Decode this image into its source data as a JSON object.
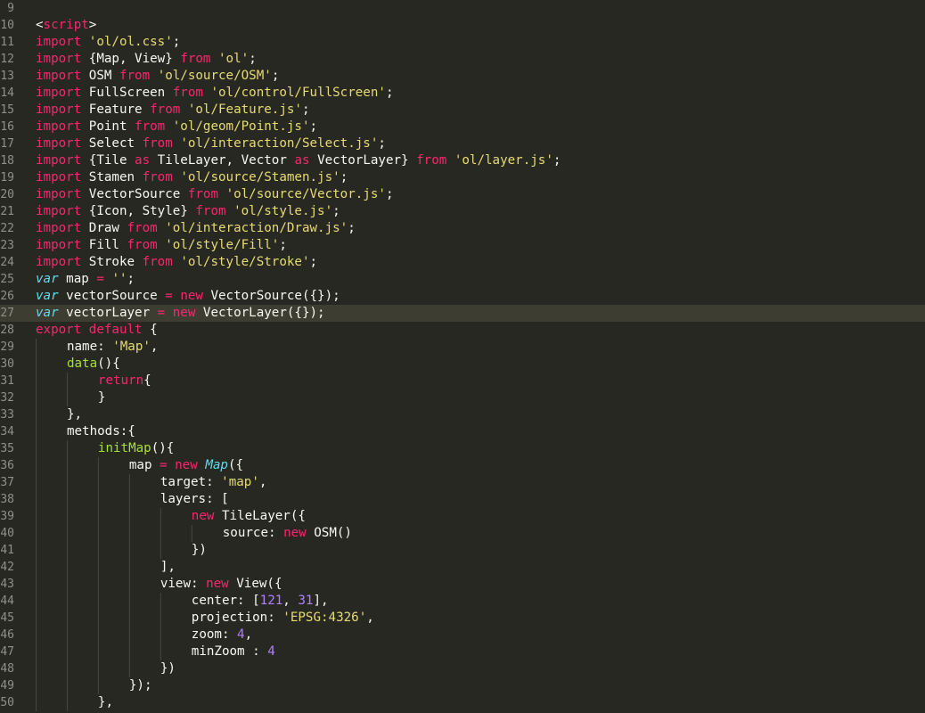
{
  "editor": {
    "theme": "Monokai",
    "colors": {
      "background": "#272822",
      "current_line": "#3e3d32",
      "gutter_text": "#90908a",
      "plain": "#f8f8f2",
      "keyword": "#f92672",
      "string": "#e6db74",
      "number": "#ae81ff",
      "function": "#a6e22e",
      "storage": "#66d9ef"
    },
    "current_line": 27,
    "lines": [
      {
        "no": "9",
        "indent": 0,
        "tokens": []
      },
      {
        "no": "10",
        "indent": 0,
        "tokens": [
          {
            "t": "p",
            "v": "<"
          },
          {
            "t": "k",
            "v": "script"
          },
          {
            "t": "p",
            "v": ">"
          }
        ]
      },
      {
        "no": "11",
        "indent": 0,
        "tokens": [
          {
            "t": "k",
            "v": "import"
          },
          {
            "t": "p",
            "v": " "
          },
          {
            "t": "s",
            "v": "'ol/ol.css'"
          },
          {
            "t": "p",
            "v": ";"
          }
        ]
      },
      {
        "no": "12",
        "indent": 0,
        "tokens": [
          {
            "t": "k",
            "v": "import"
          },
          {
            "t": "p",
            "v": " {Map, View} "
          },
          {
            "t": "k",
            "v": "from"
          },
          {
            "t": "p",
            "v": " "
          },
          {
            "t": "s",
            "v": "'ol'"
          },
          {
            "t": "p",
            "v": ";"
          }
        ]
      },
      {
        "no": "13",
        "indent": 0,
        "tokens": [
          {
            "t": "k",
            "v": "import"
          },
          {
            "t": "p",
            "v": " OSM "
          },
          {
            "t": "k",
            "v": "from"
          },
          {
            "t": "p",
            "v": " "
          },
          {
            "t": "s",
            "v": "'ol/source/OSM'"
          },
          {
            "t": "p",
            "v": ";"
          }
        ]
      },
      {
        "no": "14",
        "indent": 0,
        "tokens": [
          {
            "t": "k",
            "v": "import"
          },
          {
            "t": "p",
            "v": " FullScreen "
          },
          {
            "t": "k",
            "v": "from"
          },
          {
            "t": "p",
            "v": " "
          },
          {
            "t": "s",
            "v": "'ol/control/FullScreen'"
          },
          {
            "t": "p",
            "v": ";"
          }
        ]
      },
      {
        "no": "15",
        "indent": 0,
        "tokens": [
          {
            "t": "k",
            "v": "import"
          },
          {
            "t": "p",
            "v": " Feature "
          },
          {
            "t": "k",
            "v": "from"
          },
          {
            "t": "p",
            "v": " "
          },
          {
            "t": "s",
            "v": "'ol/Feature.js'"
          },
          {
            "t": "p",
            "v": ";"
          }
        ]
      },
      {
        "no": "16",
        "indent": 0,
        "tokens": [
          {
            "t": "k",
            "v": "import"
          },
          {
            "t": "p",
            "v": " Point "
          },
          {
            "t": "k",
            "v": "from"
          },
          {
            "t": "p",
            "v": " "
          },
          {
            "t": "s",
            "v": "'ol/geom/Point.js'"
          },
          {
            "t": "p",
            "v": ";"
          }
        ]
      },
      {
        "no": "17",
        "indent": 0,
        "tokens": [
          {
            "t": "k",
            "v": "import"
          },
          {
            "t": "p",
            "v": " Select "
          },
          {
            "t": "k",
            "v": "from"
          },
          {
            "t": "p",
            "v": " "
          },
          {
            "t": "s",
            "v": "'ol/interaction/Select.js'"
          },
          {
            "t": "p",
            "v": ";"
          }
        ]
      },
      {
        "no": "18",
        "indent": 0,
        "tokens": [
          {
            "t": "k",
            "v": "import"
          },
          {
            "t": "p",
            "v": " {Tile "
          },
          {
            "t": "k",
            "v": "as"
          },
          {
            "t": "p",
            "v": " TileLayer, Vector "
          },
          {
            "t": "k",
            "v": "as"
          },
          {
            "t": "p",
            "v": " VectorLayer} "
          },
          {
            "t": "k",
            "v": "from"
          },
          {
            "t": "p",
            "v": " "
          },
          {
            "t": "s",
            "v": "'ol/layer.js'"
          },
          {
            "t": "p",
            "v": ";"
          }
        ]
      },
      {
        "no": "19",
        "indent": 0,
        "tokens": [
          {
            "t": "k",
            "v": "import"
          },
          {
            "t": "p",
            "v": " Stamen "
          },
          {
            "t": "k",
            "v": "from"
          },
          {
            "t": "p",
            "v": " "
          },
          {
            "t": "s",
            "v": "'ol/source/Stamen.js'"
          },
          {
            "t": "p",
            "v": ";"
          }
        ]
      },
      {
        "no": "20",
        "indent": 0,
        "tokens": [
          {
            "t": "k",
            "v": "import"
          },
          {
            "t": "p",
            "v": " VectorSource "
          },
          {
            "t": "k",
            "v": "from"
          },
          {
            "t": "p",
            "v": " "
          },
          {
            "t": "s",
            "v": "'ol/source/Vector.js'"
          },
          {
            "t": "p",
            "v": ";"
          }
        ]
      },
      {
        "no": "21",
        "indent": 0,
        "tokens": [
          {
            "t": "k",
            "v": "import"
          },
          {
            "t": "p",
            "v": " {Icon, Style} "
          },
          {
            "t": "k",
            "v": "from"
          },
          {
            "t": "p",
            "v": " "
          },
          {
            "t": "s",
            "v": "'ol/style.js'"
          },
          {
            "t": "p",
            "v": ";"
          }
        ]
      },
      {
        "no": "22",
        "indent": 0,
        "tokens": [
          {
            "t": "k",
            "v": "import"
          },
          {
            "t": "p",
            "v": " Draw "
          },
          {
            "t": "k",
            "v": "from"
          },
          {
            "t": "p",
            "v": " "
          },
          {
            "t": "s",
            "v": "'ol/interaction/Draw.js'"
          },
          {
            "t": "p",
            "v": ";"
          }
        ]
      },
      {
        "no": "23",
        "indent": 0,
        "tokens": [
          {
            "t": "k",
            "v": "import"
          },
          {
            "t": "p",
            "v": " Fill "
          },
          {
            "t": "k",
            "v": "from"
          },
          {
            "t": "p",
            "v": " "
          },
          {
            "t": "s",
            "v": "'ol/style/Fill'"
          },
          {
            "t": "p",
            "v": ";"
          }
        ]
      },
      {
        "no": "24",
        "indent": 0,
        "tokens": [
          {
            "t": "k",
            "v": "import"
          },
          {
            "t": "p",
            "v": " Stroke "
          },
          {
            "t": "k",
            "v": "from"
          },
          {
            "t": "p",
            "v": " "
          },
          {
            "t": "s",
            "v": "'ol/style/Stroke'"
          },
          {
            "t": "p",
            "v": ";"
          }
        ]
      },
      {
        "no": "25",
        "indent": 0,
        "tokens": [
          {
            "t": "st",
            "v": "var"
          },
          {
            "t": "p",
            "v": " map "
          },
          {
            "t": "k",
            "v": "="
          },
          {
            "t": "p",
            "v": " "
          },
          {
            "t": "s",
            "v": "''"
          },
          {
            "t": "p",
            "v": ";"
          }
        ]
      },
      {
        "no": "26",
        "indent": 0,
        "tokens": [
          {
            "t": "st",
            "v": "var"
          },
          {
            "t": "p",
            "v": " vectorSource "
          },
          {
            "t": "k",
            "v": "="
          },
          {
            "t": "p",
            "v": " "
          },
          {
            "t": "k",
            "v": "new"
          },
          {
            "t": "p",
            "v": " VectorSource({});"
          }
        ]
      },
      {
        "no": "27",
        "indent": 0,
        "tokens": [
          {
            "t": "st",
            "v": "var"
          },
          {
            "t": "p",
            "v": " vectorLayer "
          },
          {
            "t": "k",
            "v": "="
          },
          {
            "t": "p",
            "v": " "
          },
          {
            "t": "k",
            "v": "new"
          },
          {
            "t": "p",
            "v": " VectorLayer({});"
          }
        ]
      },
      {
        "no": "28",
        "indent": 0,
        "tokens": [
          {
            "t": "k",
            "v": "export"
          },
          {
            "t": "p",
            "v": " "
          },
          {
            "t": "k",
            "v": "default"
          },
          {
            "t": "p",
            "v": " {"
          }
        ]
      },
      {
        "no": "29",
        "indent": 1,
        "tokens": [
          {
            "t": "p",
            "v": "name: "
          },
          {
            "t": "s",
            "v": "'Map'"
          },
          {
            "t": "p",
            "v": ","
          }
        ]
      },
      {
        "no": "30",
        "indent": 1,
        "tokens": [
          {
            "t": "f",
            "v": "data"
          },
          {
            "t": "p",
            "v": "(){"
          }
        ]
      },
      {
        "no": "31",
        "indent": 2,
        "tokens": [
          {
            "t": "k",
            "v": "return"
          },
          {
            "t": "p",
            "v": "{"
          }
        ]
      },
      {
        "no": "32",
        "indent": 2,
        "tokens": [
          {
            "t": "p",
            "v": "}"
          }
        ]
      },
      {
        "no": "33",
        "indent": 1,
        "tokens": [
          {
            "t": "p",
            "v": "},"
          }
        ]
      },
      {
        "no": "34",
        "indent": 1,
        "tokens": [
          {
            "t": "p",
            "v": "methods:{"
          }
        ]
      },
      {
        "no": "35",
        "indent": 2,
        "tokens": [
          {
            "t": "f",
            "v": "initMap"
          },
          {
            "t": "p",
            "v": "(){"
          }
        ]
      },
      {
        "no": "36",
        "indent": 3,
        "tokens": [
          {
            "t": "p",
            "v": "map "
          },
          {
            "t": "k",
            "v": "="
          },
          {
            "t": "p",
            "v": " "
          },
          {
            "t": "k",
            "v": "new"
          },
          {
            "t": "p",
            "v": " "
          },
          {
            "t": "st",
            "v": "Map"
          },
          {
            "t": "p",
            "v": "({"
          }
        ]
      },
      {
        "no": "37",
        "indent": 4,
        "tokens": [
          {
            "t": "p",
            "v": "target: "
          },
          {
            "t": "s",
            "v": "'map'"
          },
          {
            "t": "p",
            "v": ","
          }
        ]
      },
      {
        "no": "38",
        "indent": 4,
        "tokens": [
          {
            "t": "p",
            "v": "layers: ["
          }
        ]
      },
      {
        "no": "39",
        "indent": 5,
        "tokens": [
          {
            "t": "k",
            "v": "new"
          },
          {
            "t": "p",
            "v": " TileLayer({"
          }
        ]
      },
      {
        "no": "40",
        "indent": 6,
        "tokens": [
          {
            "t": "p",
            "v": "source: "
          },
          {
            "t": "k",
            "v": "new"
          },
          {
            "t": "p",
            "v": " OSM()"
          }
        ]
      },
      {
        "no": "41",
        "indent": 5,
        "tokens": [
          {
            "t": "p",
            "v": "})"
          }
        ]
      },
      {
        "no": "42",
        "indent": 4,
        "tokens": [
          {
            "t": "p",
            "v": "],"
          }
        ]
      },
      {
        "no": "43",
        "indent": 4,
        "tokens": [
          {
            "t": "p",
            "v": "view: "
          },
          {
            "t": "k",
            "v": "new"
          },
          {
            "t": "p",
            "v": " View({"
          }
        ]
      },
      {
        "no": "44",
        "indent": 5,
        "tokens": [
          {
            "t": "p",
            "v": "center: ["
          },
          {
            "t": "n",
            "v": "121"
          },
          {
            "t": "p",
            "v": ", "
          },
          {
            "t": "n",
            "v": "31"
          },
          {
            "t": "p",
            "v": "],"
          }
        ]
      },
      {
        "no": "45",
        "indent": 5,
        "tokens": [
          {
            "t": "p",
            "v": "projection: "
          },
          {
            "t": "s",
            "v": "'EPSG:4326'"
          },
          {
            "t": "p",
            "v": ","
          }
        ]
      },
      {
        "no": "46",
        "indent": 5,
        "tokens": [
          {
            "t": "p",
            "v": "zoom: "
          },
          {
            "t": "n",
            "v": "4"
          },
          {
            "t": "p",
            "v": ","
          }
        ]
      },
      {
        "no": "47",
        "indent": 5,
        "tokens": [
          {
            "t": "p",
            "v": "minZoom : "
          },
          {
            "t": "n",
            "v": "4"
          }
        ]
      },
      {
        "no": "48",
        "indent": 4,
        "tokens": [
          {
            "t": "p",
            "v": "})"
          }
        ]
      },
      {
        "no": "49",
        "indent": 3,
        "tokens": [
          {
            "t": "p",
            "v": "});"
          }
        ]
      },
      {
        "no": "50",
        "indent": 2,
        "tokens": [
          {
            "t": "p",
            "v": "},"
          }
        ]
      }
    ]
  }
}
